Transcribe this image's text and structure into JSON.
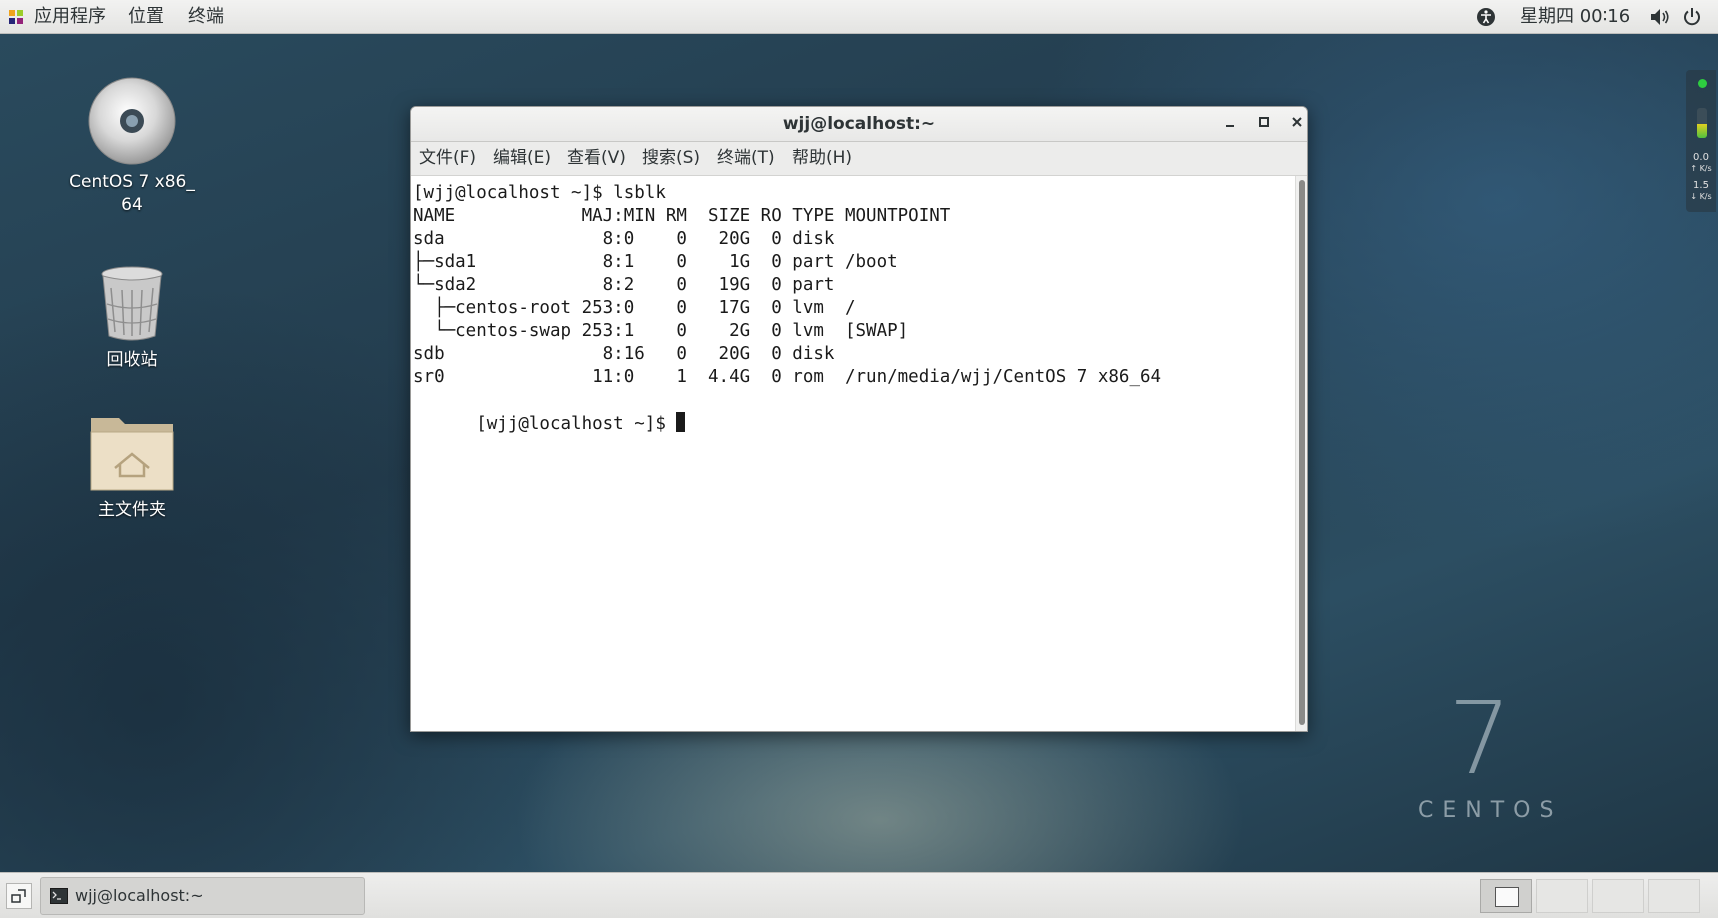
{
  "topbar": {
    "apps_label": "应用程序",
    "places_label": "位置",
    "terminal_label": "终端",
    "datetime": "星期四 00∶16"
  },
  "desktop": {
    "dvd_label_line1": "CentOS 7 x86_",
    "dvd_label_line2": "64",
    "trash_label": "回收站",
    "home_label": "主文件夹"
  },
  "side_widget": {
    "up_value": "0.0",
    "up_unit": "K/s",
    "down_value": "1.5",
    "down_unit": "K/s"
  },
  "window": {
    "title": "wjj@localhost:~",
    "menu": {
      "file": "文件(F)",
      "edit": "编辑(E)",
      "view": "查看(V)",
      "search": "搜索(S)",
      "terminal": "终端(T)",
      "help": "帮助(H)"
    },
    "terminal_lines": [
      "[wjj@localhost ~]$ lsblk",
      "NAME            MAJ:MIN RM  SIZE RO TYPE MOUNTPOINT",
      "sda               8:0    0   20G  0 disk",
      "├─sda1            8:1    0    1G  0 part /boot",
      "└─sda2            8:2    0   19G  0 part",
      "  ├─centos-root 253:0    0   17G  0 lvm  /",
      "  └─centos-swap 253:1    0    2G  0 lvm  [SWAP]",
      "sdb               8:16   0   20G  0 disk",
      "sr0              11:0    1  4.4G  0 rom  /run/media/wjj/CentOS 7 x86_64",
      "[wjj@localhost ~]$ "
    ]
  },
  "watermark": {
    "number": "7",
    "text": "CENTOS"
  },
  "taskbar": {
    "task_label": "wjj@localhost:~"
  }
}
